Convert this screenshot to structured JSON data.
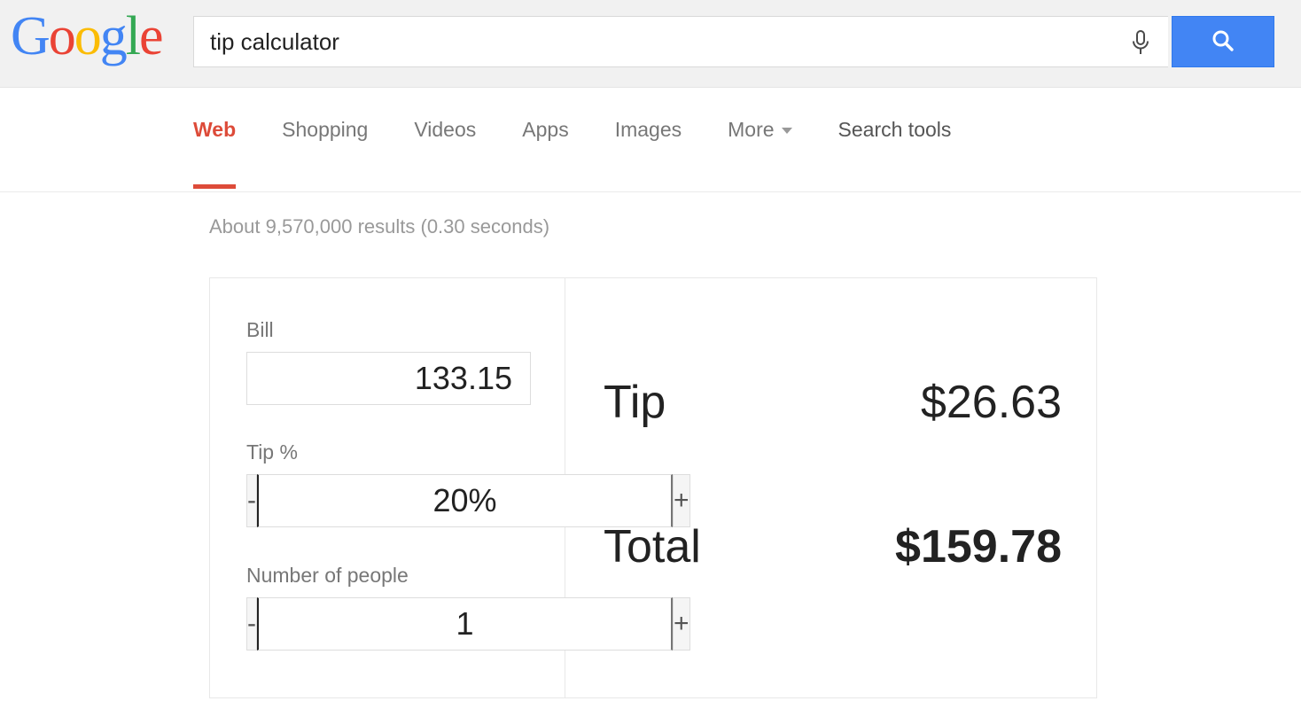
{
  "header": {
    "logo": {
      "letters": [
        {
          "char": "G",
          "color": "#4285f4"
        },
        {
          "char": "o",
          "color": "#ea4335"
        },
        {
          "char": "o",
          "color": "#fbbc05"
        },
        {
          "char": "g",
          "color": "#4285f4"
        },
        {
          "char": "l",
          "color": "#34a853"
        },
        {
          "char": "e",
          "color": "#ea4335"
        }
      ],
      "text": "Google"
    },
    "search": {
      "value": "tip calculator",
      "placeholder": "Search",
      "mic_icon": "microphone-icon",
      "button_icon": "search-icon",
      "button_color": "#4285f4"
    }
  },
  "tabs": {
    "items": [
      {
        "label": "Web",
        "active": true
      },
      {
        "label": "Shopping",
        "active": false
      },
      {
        "label": "Videos",
        "active": false
      },
      {
        "label": "Apps",
        "active": false
      },
      {
        "label": "Images",
        "active": false
      },
      {
        "label": "More",
        "active": false,
        "caret": true
      }
    ],
    "search_tools": "Search tools",
    "active_color": "#dd4b39"
  },
  "results": {
    "stats": "About 9,570,000 results (0.30 seconds)"
  },
  "calculator": {
    "bill": {
      "label": "Bill",
      "value": "133.15"
    },
    "tip_percent": {
      "label": "Tip %",
      "value": "20%",
      "decrement": "-",
      "increment": "+"
    },
    "people": {
      "label": "Number of people",
      "value": "1",
      "decrement": "-",
      "increment": "+"
    },
    "output": {
      "tip_label": "Tip",
      "tip_value": "$26.63",
      "total_label": "Total",
      "total_value": "$159.78"
    }
  }
}
